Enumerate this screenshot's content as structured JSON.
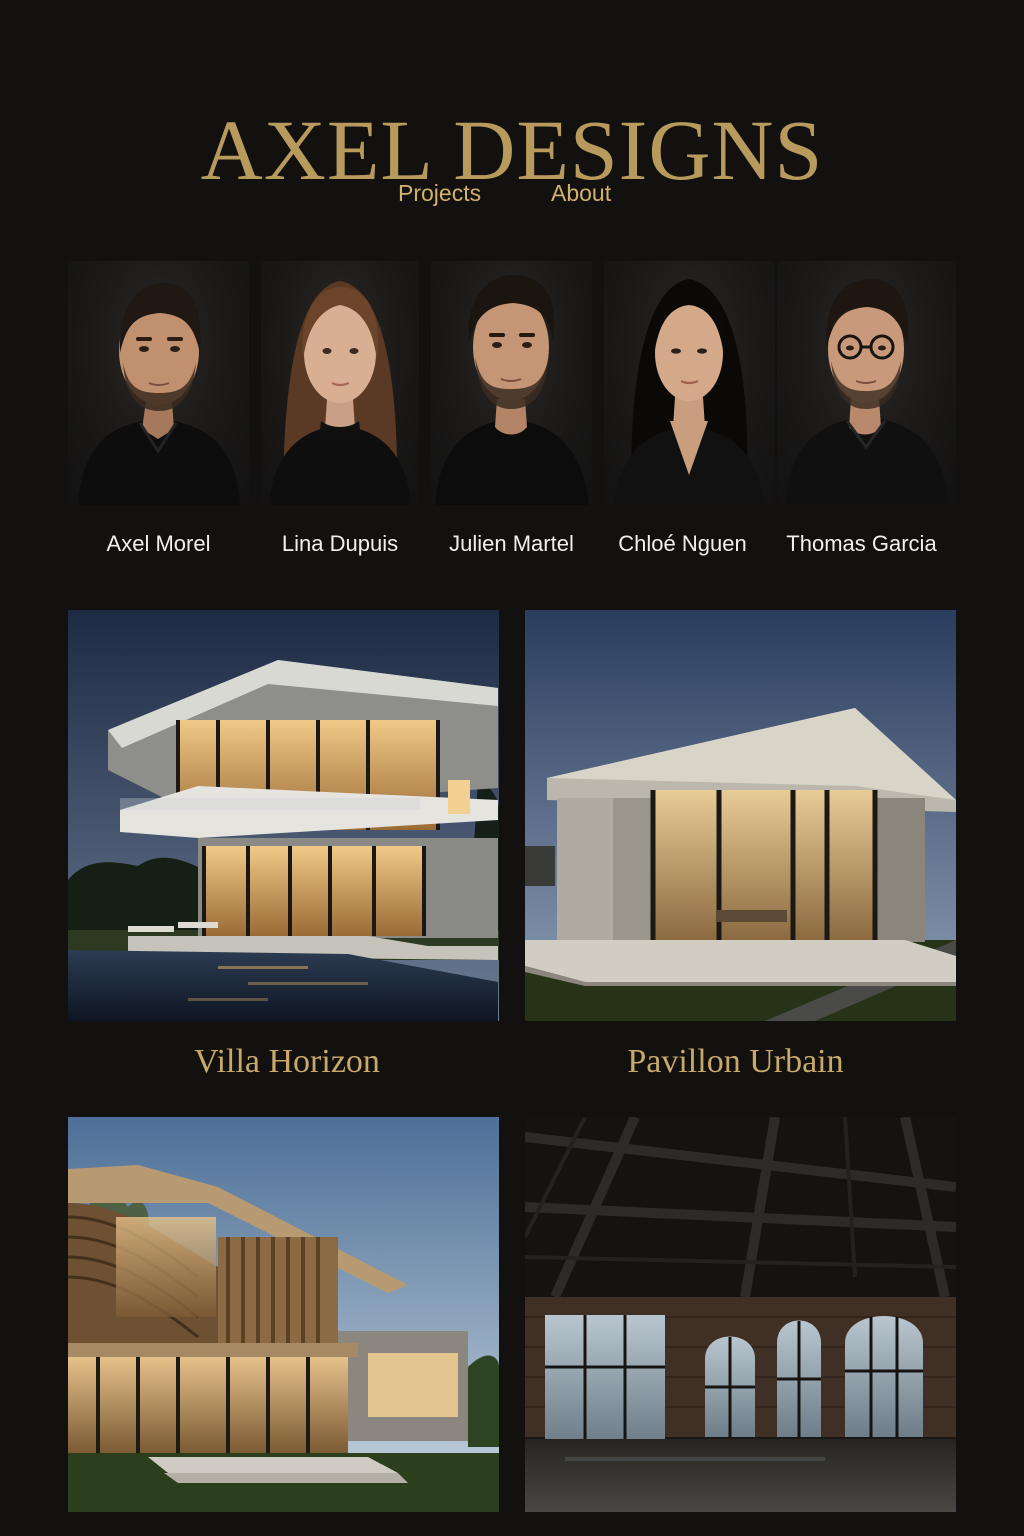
{
  "brand": {
    "name": "AXEL DESIGNS",
    "color": "#b89a5c"
  },
  "nav": {
    "items": [
      {
        "label": "Projects"
      },
      {
        "label": "About"
      }
    ],
    "color": "#d2b16c"
  },
  "team": [
    {
      "name": "Axel Morel",
      "hair": "dark-short",
      "beard": true,
      "glasses": false
    },
    {
      "name": "Lina Dupuis",
      "hair": "long-brown",
      "beard": false,
      "glasses": false
    },
    {
      "name": "Julien Martel",
      "hair": "dark-short",
      "beard": true,
      "glasses": false
    },
    {
      "name": "Chloé Nguen",
      "hair": "long-black",
      "beard": false,
      "glasses": false
    },
    {
      "name": "Thomas Garcia",
      "hair": "dark-short",
      "beard": true,
      "glasses": true
    }
  ],
  "projects": [
    {
      "title": "Villa Horizon",
      "scene": "modern-villa-with-pool"
    },
    {
      "title": "Pavillon Urbain",
      "scene": "glass-pavilion"
    },
    {
      "title": "",
      "scene": "curved-wood-facade-house"
    },
    {
      "title": "",
      "scene": "industrial-loft-interior"
    }
  ],
  "colors": {
    "background": "#121110",
    "accent": "#c8a96a",
    "text": "#f2f0ec"
  }
}
